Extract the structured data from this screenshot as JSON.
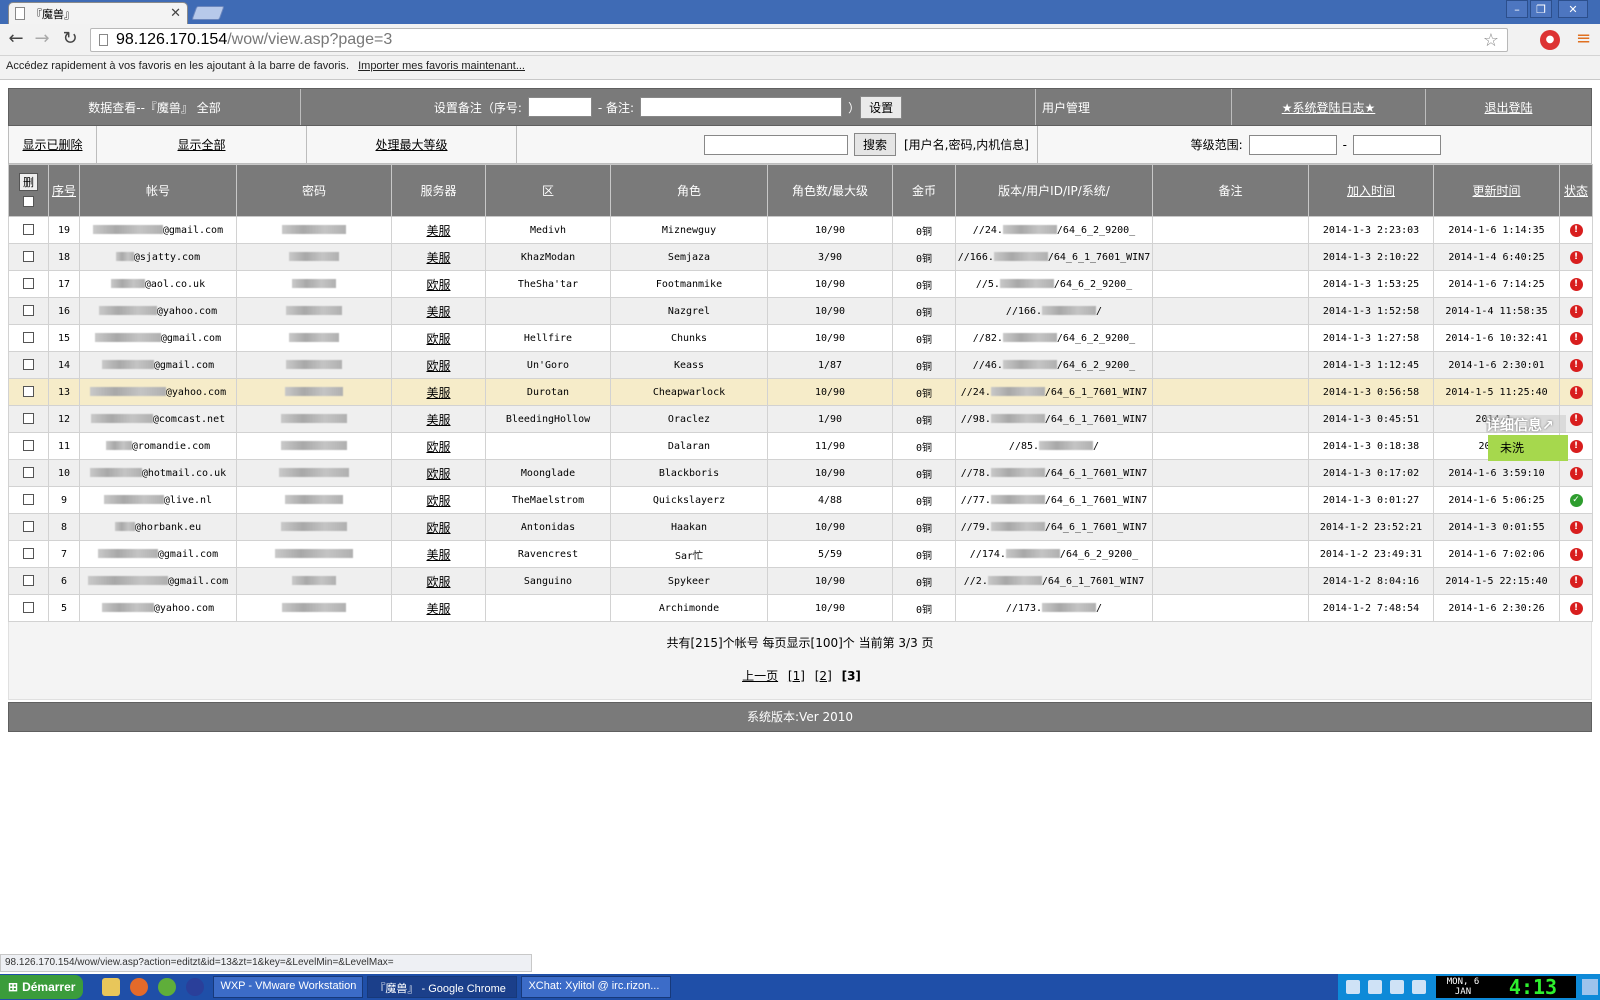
{
  "browser": {
    "tab_title": "『魔兽』",
    "url_host": "98.126.170.154",
    "url_path": "/wow/view.asp?page=3",
    "bookmark_text": "Accédez rapidement à vos favoris en les ajoutant à la barre de favoris.",
    "bookmark_link": "Importer mes favoris maintenant...",
    "status_url": "98.126.170.154/wow/view.asp?action=editzt&id=13&zt=1&key=&LevelMin=&LevelMax="
  },
  "header1": {
    "title": "数据查看--『魔兽』 全部",
    "remark_label_1": "设置备注（序号:",
    "remark_label_2": "- 备注:",
    "remark_label_3": "）",
    "set_button": "设置",
    "user_mgmt": "用户管理",
    "sys_log": "★系统登陆日志★",
    "logout": "退出登陆"
  },
  "header2": {
    "show_deleted": "显示已删除",
    "show_all": "显示全部",
    "process_max": "处理最大等级",
    "search_button": "搜索",
    "search_hint": "[用户名,密码,内机信息]",
    "level_range": "等级范围:",
    "level_sep": "-"
  },
  "table": {
    "delete_button": "删",
    "columns": [
      "序号",
      "帐号",
      "密码",
      "服务器",
      "区",
      "角色",
      "角色数/最大级",
      "金币",
      "版本/用户ID/IP/系统/",
      "备注",
      "加入时间",
      "更新时间",
      "状态"
    ],
    "rows": [
      {
        "id": "19",
        "acct": "@gmail.com",
        "server": "美服",
        "realm": "Medivh",
        "char": "Miznewguy",
        "lvl": "10/90",
        "gold": "0铜",
        "ver_a": "//24.",
        "ver_b": "/64_6_2_9200_",
        "added": "2014-1-3 2:23:03",
        "updated": "2014-1-6 1:14:35",
        "status": "red",
        "style": ""
      },
      {
        "id": "18",
        "acct": "@sjatty.com",
        "server": "美服",
        "realm": "KhazModan",
        "char": "Semjaza",
        "lvl": "3/90",
        "gold": "0铜",
        "ver_a": "//166.",
        "ver_b": "/64_6_1_7601_WIN7",
        "added": "2014-1-3 2:10:22",
        "updated": "2014-1-4 6:40:25",
        "status": "red",
        "style": "alt"
      },
      {
        "id": "17",
        "acct": "@aol.co.uk",
        "server": "欧服",
        "realm": "TheSha'tar",
        "char": "Footmanmike",
        "lvl": "10/90",
        "gold": "0铜",
        "ver_a": "//5.",
        "ver_b": "/64_6_2_9200_",
        "added": "2014-1-3 1:53:25",
        "updated": "2014-1-6 7:14:25",
        "status": "red",
        "style": ""
      },
      {
        "id": "16",
        "acct": "@yahoo.com",
        "server": "美服",
        "realm": "",
        "char": "Nazgrel",
        "lvl": "10/90",
        "gold": "0铜",
        "ver_a": "//166.",
        "ver_b": "/",
        "added": "2014-1-3 1:52:58",
        "updated": "2014-1-4 11:58:35",
        "status": "red",
        "style": "alt"
      },
      {
        "id": "15",
        "acct": "@gmail.com",
        "server": "欧服",
        "realm": "Hellfire",
        "char": "Chunks",
        "lvl": "10/90",
        "gold": "0铜",
        "ver_a": "//82.",
        "ver_b": "/64_6_2_9200_",
        "added": "2014-1-3 1:27:58",
        "updated": "2014-1-6 10:32:41",
        "status": "red",
        "style": ""
      },
      {
        "id": "14",
        "acct": "@gmail.com",
        "server": "欧服",
        "realm": "Un'Goro",
        "char": "Keass",
        "lvl": "1/87",
        "gold": "0铜",
        "ver_a": "//46.",
        "ver_b": "/64_6_2_9200_",
        "added": "2014-1-3 1:12:45",
        "updated": "2014-1-6 2:30:01",
        "status": "red",
        "style": "alt"
      },
      {
        "id": "13",
        "acct": "@yahoo.com",
        "server": "美服",
        "realm": "Durotan",
        "char": "Cheapwarlock",
        "lvl": "10/90",
        "gold": "0铜",
        "ver_a": "//24.",
        "ver_b": "/64_6_1_7601_WIN7",
        "added": "2014-1-3 0:56:58",
        "updated": "2014-1-5 11:25:40",
        "status": "red",
        "style": "hl"
      },
      {
        "id": "12",
        "acct": "@comcast.net",
        "server": "美服",
        "realm": "BleedingHollow",
        "char": "Oraclez",
        "lvl": "1/90",
        "gold": "0铜",
        "ver_a": "//98.",
        "ver_b": "/64_6_1_7601_WIN7",
        "added": "2014-1-3 0:45:51",
        "updated": "2014-1-",
        "status": "red",
        "style": "alt"
      },
      {
        "id": "11",
        "acct": "@romandie.com",
        "server": "欧服",
        "realm": "",
        "char": "Dalaran",
        "lvl": "11/90",
        "gold": "0铜",
        "ver_a": "//85.",
        "ver_b": "/",
        "added": "2014-1-3 0:18:38",
        "updated": "2014-1",
        "status": "red",
        "style": ""
      },
      {
        "id": "10",
        "acct": "@hotmail.co.uk",
        "server": "欧服",
        "realm": "Moonglade",
        "char": "Blackboris",
        "lvl": "10/90",
        "gold": "0铜",
        "ver_a": "//78.",
        "ver_b": "/64_6_1_7601_WIN7",
        "added": "2014-1-3 0:17:02",
        "updated": "2014-1-6 3:59:10",
        "status": "red",
        "style": "alt"
      },
      {
        "id": "9",
        "acct": "@live.nl",
        "server": "欧服",
        "realm": "TheMaelstrom",
        "char": "Quickslayerz",
        "lvl": "4/88",
        "gold": "0铜",
        "ver_a": "//77.",
        "ver_b": "/64_6_1_7601_WIN7",
        "added": "2014-1-3 0:01:27",
        "updated": "2014-1-6 5:06:25",
        "status": "green",
        "style": ""
      },
      {
        "id": "8",
        "acct": "@horbank.eu",
        "server": "欧服",
        "realm": "Antonidas",
        "char": "Haakan",
        "lvl": "10/90",
        "gold": "0铜",
        "ver_a": "//79.",
        "ver_b": "/64_6_1_7601_WIN7",
        "added": "2014-1-2 23:52:21",
        "updated": "2014-1-3 0:01:55",
        "status": "red",
        "style": "alt"
      },
      {
        "id": "7",
        "acct": "@gmail.com",
        "server": "美服",
        "realm": "Ravencrest",
        "char": "Sar忙",
        "lvl": "5/59",
        "gold": "0铜",
        "ver_a": "//174.",
        "ver_b": "/64_6_2_9200_",
        "added": "2014-1-2 23:49:31",
        "updated": "2014-1-6 7:02:06",
        "status": "red",
        "style": ""
      },
      {
        "id": "6",
        "acct": "@gmail.com",
        "server": "欧服",
        "realm": "Sanguino",
        "char": "Spykeer",
        "lvl": "10/90",
        "gold": "0铜",
        "ver_a": "//2.",
        "ver_b": "/64_6_1_7601_WIN7",
        "added": "2014-1-2 8:04:16",
        "updated": "2014-1-5 22:15:40",
        "status": "red",
        "style": "alt"
      },
      {
        "id": "5",
        "acct": "@yahoo.com",
        "server": "美服",
        "realm": "",
        "char": "Archimonde",
        "lvl": "10/90",
        "gold": "0铜",
        "ver_a": "//173.",
        "ver_b": "/",
        "added": "2014-1-2 7:48:54",
        "updated": "2014-1-6 2:30:26",
        "status": "red",
        "style": ""
      }
    ]
  },
  "footer": {
    "summary": "共有[215]个帐号  每页显示[100]个  当前第 3/3 页",
    "prev": "上一页",
    "page1": "[1]",
    "page2": "[2]",
    "page3": "[3]",
    "version": "系统版本:Ver 2010"
  },
  "popup": {
    "title": "详细信息↗",
    "body": "未洗"
  },
  "taskbar": {
    "start": "Démarrer",
    "tasks": [
      "WXP - VMware Workstation",
      "『魔兽』 - Google Chrome",
      "XChat: Xylitol @ irc.rizon..."
    ],
    "clock_date": "MON, 6 JAN",
    "clock_time": "4:13"
  },
  "colors": {
    "header_gray": "#7a7a7a",
    "highlight_row": "#f6ecc9",
    "popup_green": "#a6d84d",
    "status_red": "#d81e1e",
    "status_green": "#2e9d2e"
  }
}
